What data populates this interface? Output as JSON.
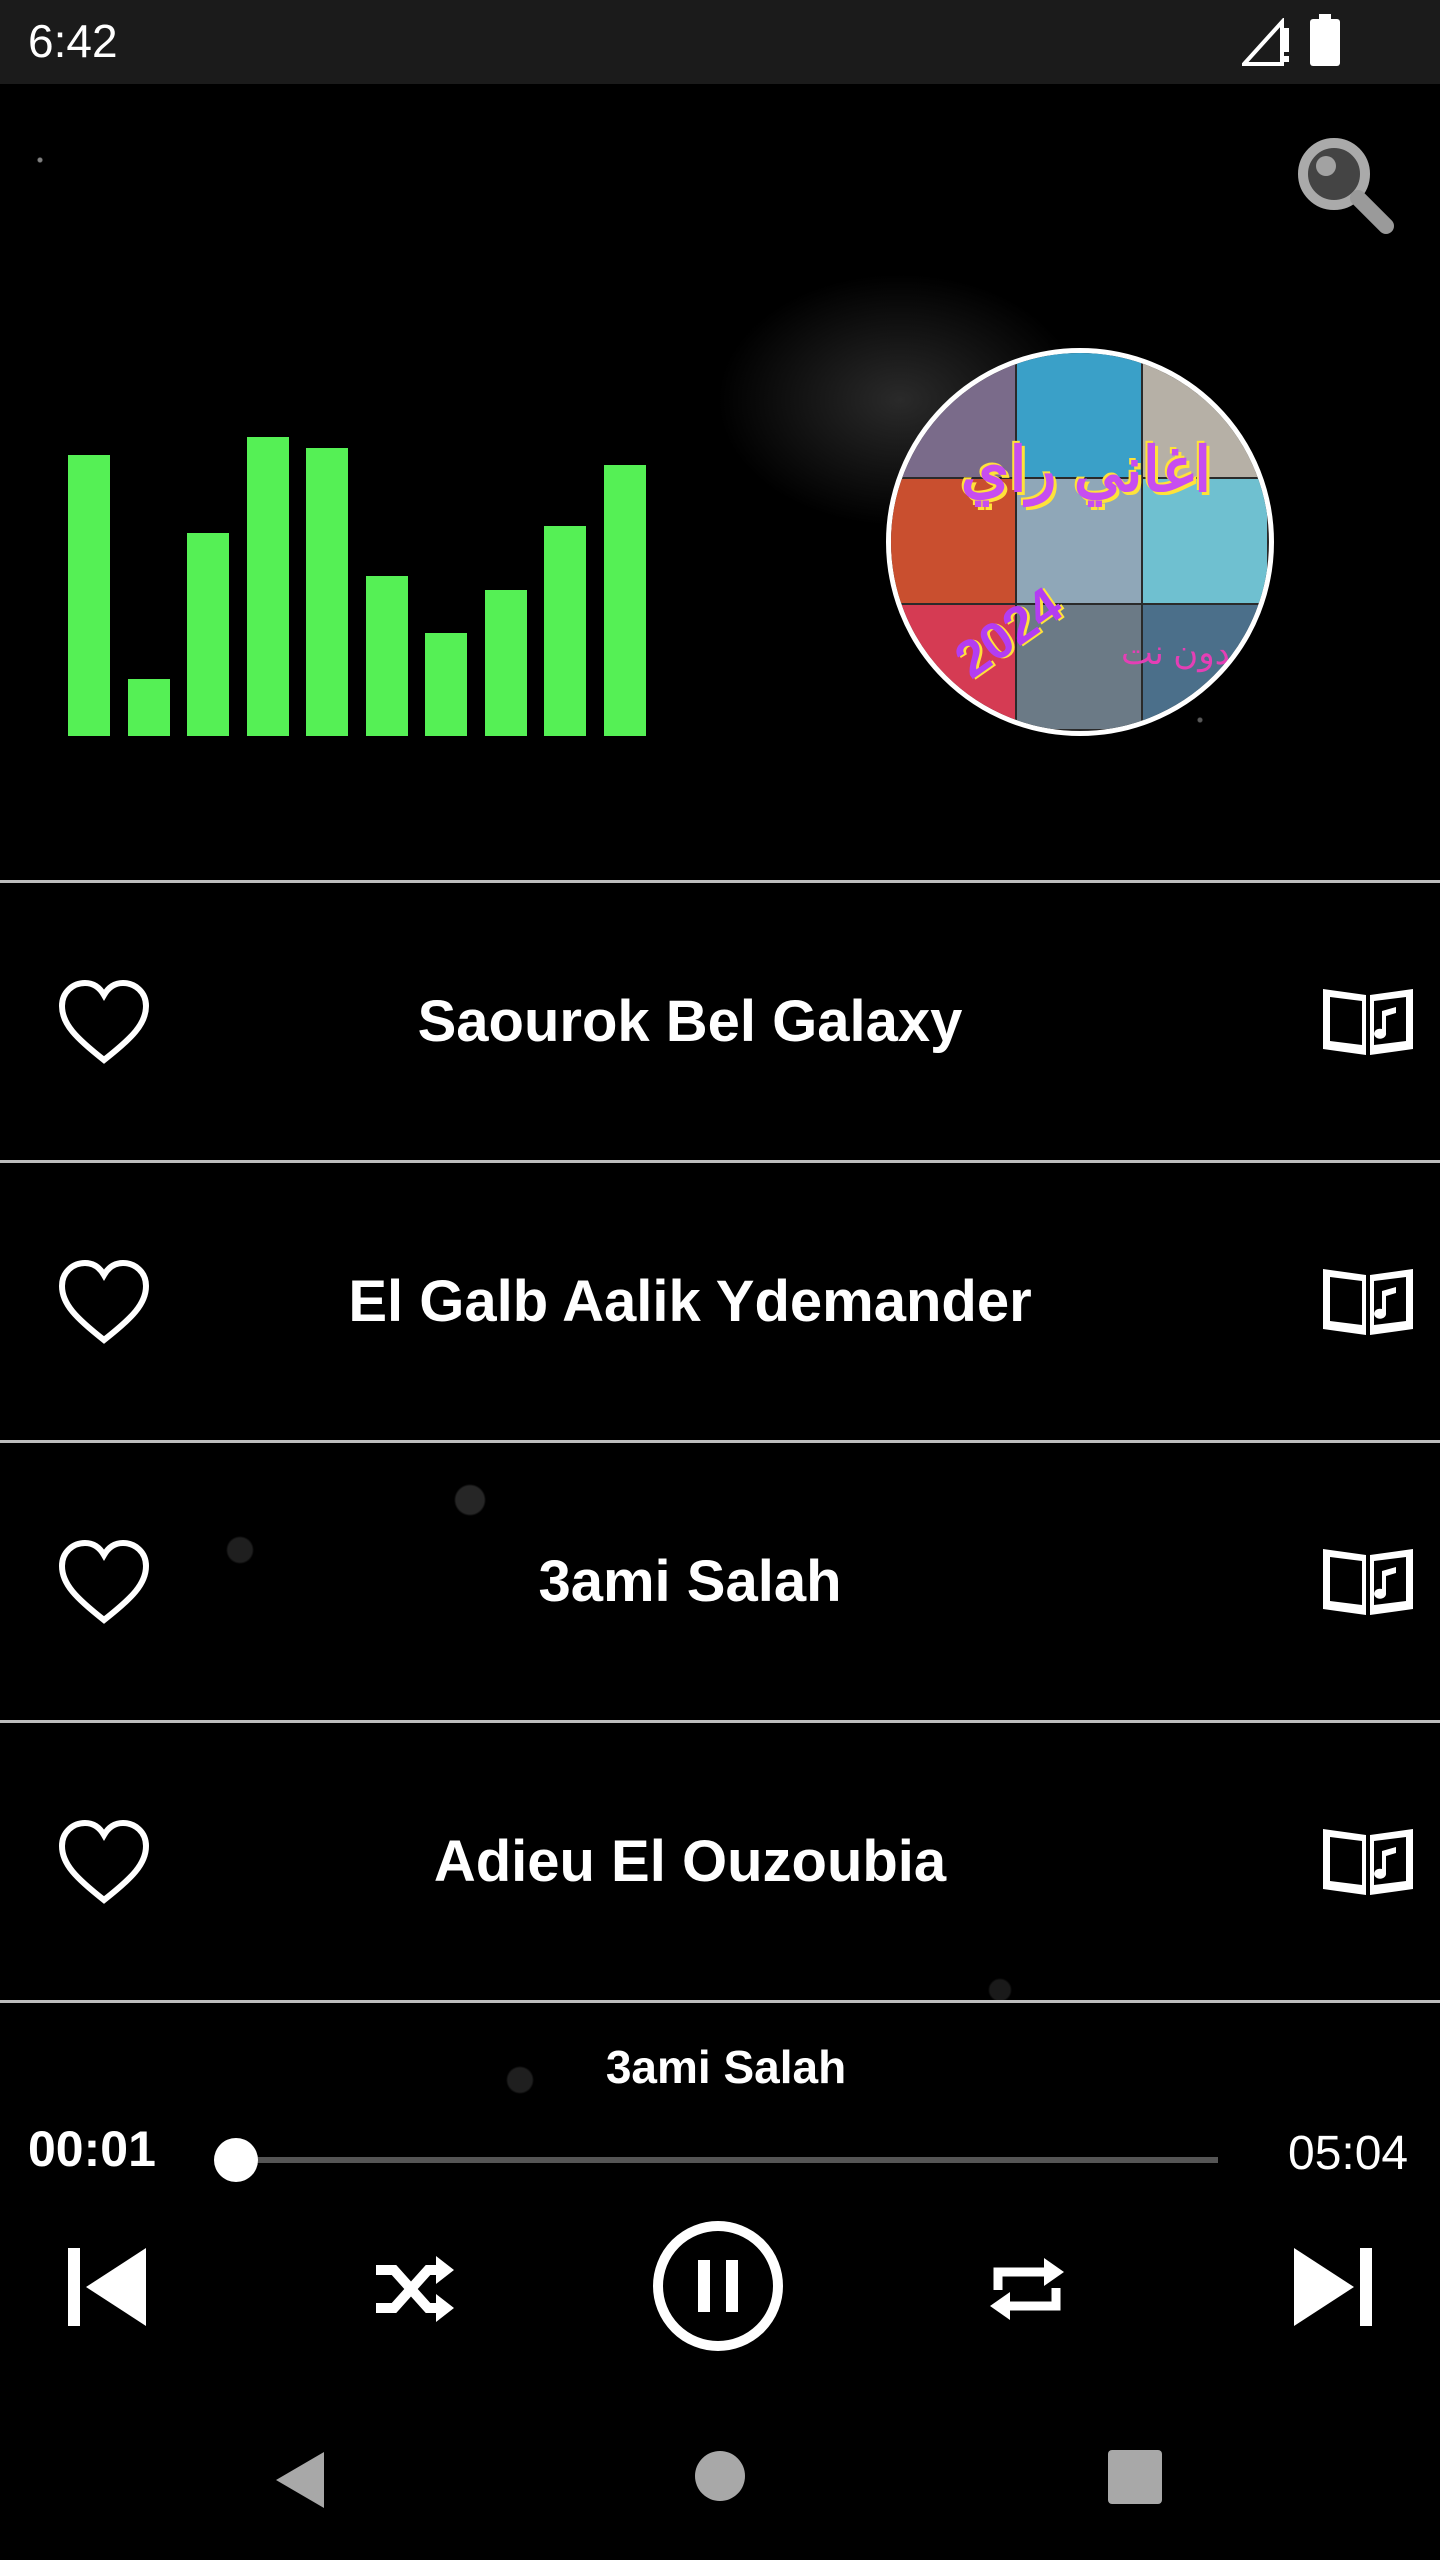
{
  "status_bar": {
    "time": "6:42",
    "signal_icon": "signal-warning-icon",
    "battery_icon": "battery-full-icon"
  },
  "header": {
    "search_icon": "search-icon"
  },
  "equalizer": {
    "levels": [
      0.79,
      0.16,
      0.57,
      0.84,
      0.81,
      0.45,
      0.29,
      0.41,
      0.59,
      0.76
    ],
    "color": "#55f055"
  },
  "album_art": {
    "text_title": "اغاني راي",
    "text_year": "2024",
    "text_subtitle": "بدون نت"
  },
  "songs": [
    {
      "title": "Saourok Bel Galaxy"
    },
    {
      "title": "El Galb Aalik Ydemander"
    },
    {
      "title": "3ami Salah"
    },
    {
      "title": "Adieu El Ouzoubia"
    }
  ],
  "player": {
    "now_playing": "3ami Salah",
    "elapsed": "00:01",
    "duration": "05:04",
    "progress": 0.003
  }
}
